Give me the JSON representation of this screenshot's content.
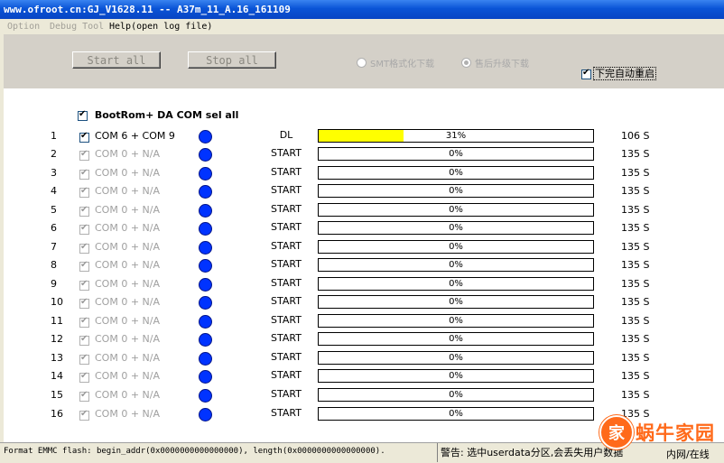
{
  "window": {
    "title": "www.ofroot.cn:GJ_V1628.11 -- A37m_11_A.16_161109"
  },
  "menu": {
    "option": "Option",
    "debug": "Debug Tool",
    "help": "Help(open log file)"
  },
  "toolbar": {
    "start_all": "Start all",
    "stop_all": "Stop all",
    "radio_smt": "SMT格式化下载",
    "radio_upgrade": "售后升级下载",
    "reboot_label": "下完自动重启"
  },
  "select_all": {
    "label": "BootRom+ DA COM sel all",
    "checked": true
  },
  "rows": [
    {
      "num": "1",
      "port": "COM 6 + COM 9",
      "status": "DL",
      "progress": "31%",
      "progress_value": 31,
      "time": "106 S",
      "enabled": true,
      "checked": true
    },
    {
      "num": "2",
      "port": "COM 0 + N/A",
      "status": "START",
      "progress": "0%",
      "progress_value": 0,
      "time": "135 S",
      "enabled": false,
      "checked": true
    },
    {
      "num": "3",
      "port": "COM 0 + N/A",
      "status": "START",
      "progress": "0%",
      "progress_value": 0,
      "time": "135 S",
      "enabled": false,
      "checked": true
    },
    {
      "num": "4",
      "port": "COM 0 + N/A",
      "status": "START",
      "progress": "0%",
      "progress_value": 0,
      "time": "135 S",
      "enabled": false,
      "checked": true
    },
    {
      "num": "5",
      "port": "COM 0 + N/A",
      "status": "START",
      "progress": "0%",
      "progress_value": 0,
      "time": "135 S",
      "enabled": false,
      "checked": true
    },
    {
      "num": "6",
      "port": "COM 0 + N/A",
      "status": "START",
      "progress": "0%",
      "progress_value": 0,
      "time": "135 S",
      "enabled": false,
      "checked": true
    },
    {
      "num": "7",
      "port": "COM 0 + N/A",
      "status": "START",
      "progress": "0%",
      "progress_value": 0,
      "time": "135 S",
      "enabled": false,
      "checked": true
    },
    {
      "num": "8",
      "port": "COM 0 + N/A",
      "status": "START",
      "progress": "0%",
      "progress_value": 0,
      "time": "135 S",
      "enabled": false,
      "checked": true
    },
    {
      "num": "9",
      "port": "COM 0 + N/A",
      "status": "START",
      "progress": "0%",
      "progress_value": 0,
      "time": "135 S",
      "enabled": false,
      "checked": true
    },
    {
      "num": "10",
      "port": "COM 0 + N/A",
      "status": "START",
      "progress": "0%",
      "progress_value": 0,
      "time": "135 S",
      "enabled": false,
      "checked": true
    },
    {
      "num": "11",
      "port": "COM 0 + N/A",
      "status": "START",
      "progress": "0%",
      "progress_value": 0,
      "time": "135 S",
      "enabled": false,
      "checked": true
    },
    {
      "num": "12",
      "port": "COM 0 + N/A",
      "status": "START",
      "progress": "0%",
      "progress_value": 0,
      "time": "135 S",
      "enabled": false,
      "checked": true
    },
    {
      "num": "13",
      "port": "COM 0 + N/A",
      "status": "START",
      "progress": "0%",
      "progress_value": 0,
      "time": "135 S",
      "enabled": false,
      "checked": true
    },
    {
      "num": "14",
      "port": "COM 0 + N/A",
      "status": "START",
      "progress": "0%",
      "progress_value": 0,
      "time": "135 S",
      "enabled": false,
      "checked": true
    },
    {
      "num": "15",
      "port": "COM 0 + N/A",
      "status": "START",
      "progress": "0%",
      "progress_value": 0,
      "time": "135 S",
      "enabled": false,
      "checked": true
    },
    {
      "num": "16",
      "port": "COM 0 + N/A",
      "status": "START",
      "progress": "0%",
      "progress_value": 0,
      "time": "135 S",
      "enabled": false,
      "checked": true
    }
  ],
  "statusbar": {
    "format_info": "Format EMMC flash:  begin_addr(0x0000000000000000), length(0x0000000000000000).",
    "warning": "警告: 选中userdata分区,会丢失用户数据",
    "network": "内网/在线"
  },
  "watermark": {
    "glyph": "家",
    "text": "蜗牛家园"
  },
  "colors": {
    "progress_fill": "#ffff00",
    "status_dot": "#0033ff",
    "titlebar": "#0a54d6"
  }
}
